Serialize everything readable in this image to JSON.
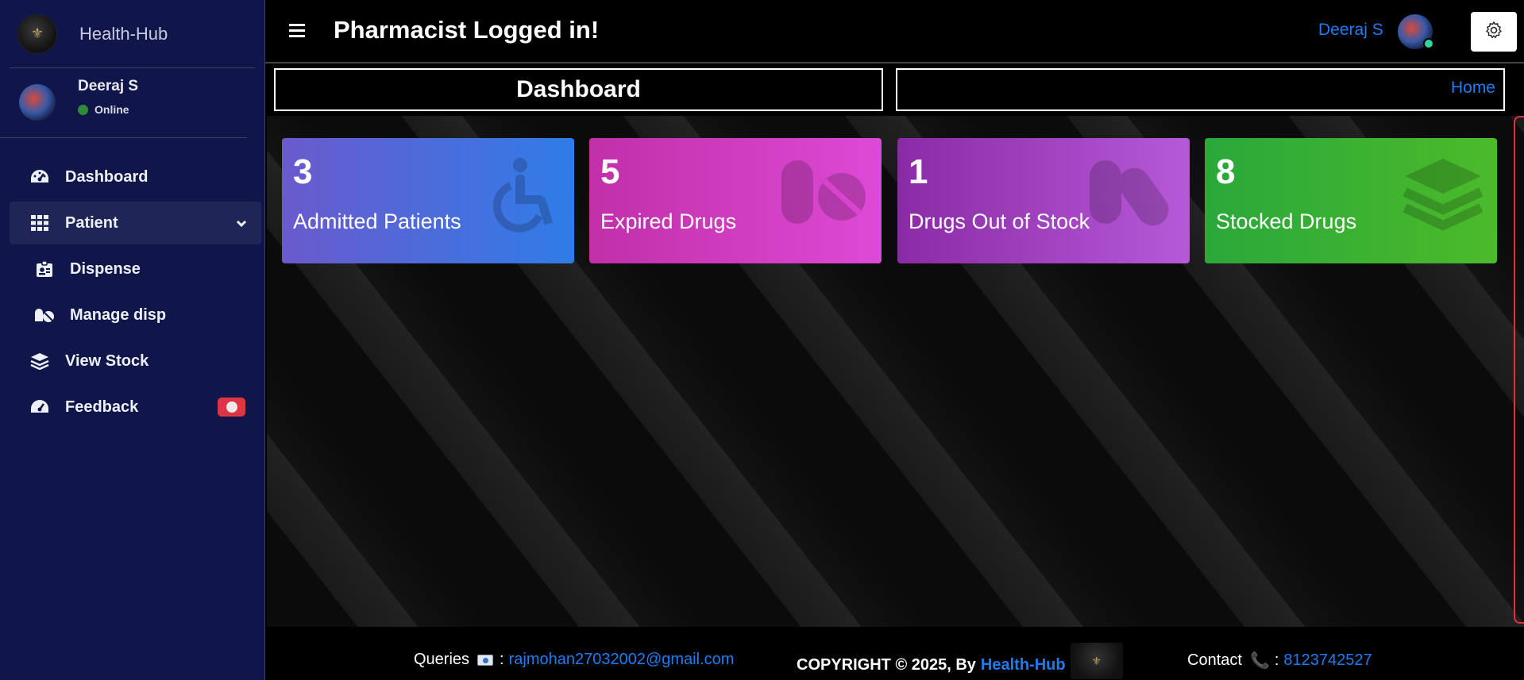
{
  "sidebar": {
    "brand": "Health-Hub",
    "user": {
      "name": "Deeraj S",
      "status": "Online"
    },
    "items": [
      {
        "label": "Dashboard",
        "icon": "tachometer-icon"
      },
      {
        "label": "Patient",
        "icon": "grid-icon"
      },
      {
        "label": "Dispense",
        "icon": "id-badge-icon"
      },
      {
        "label": "Manage disp",
        "icon": "pills-icon"
      },
      {
        "label": "View Stock",
        "icon": "layers-icon"
      },
      {
        "label": "Feedback",
        "icon": "tachometer-icon"
      }
    ]
  },
  "topbar": {
    "title": "Pharmacist Logged in!",
    "username": "Deeraj S"
  },
  "content": {
    "title": "Dashboard",
    "breadcrumb": "Home"
  },
  "cards": [
    {
      "value": "3",
      "label": "Admitted Patients",
      "icon": "wheelchair-icon",
      "color_from": "#6a5acd",
      "color_to": "#2f7de8"
    },
    {
      "value": "5",
      "label": "Expired Drugs",
      "icon": "prescription-bottle-icon",
      "color_from": "#c030a8",
      "color_to": "#dd4ad6"
    },
    {
      "value": "1",
      "label": "Drugs Out of Stock",
      "icon": "capsules-icon",
      "color_from": "#8a2aa6",
      "color_to": "#b75ad8"
    },
    {
      "value": "8",
      "label": "Stocked Drugs",
      "icon": "layers-icon",
      "color_from": "#2aa83a",
      "color_to": "#4cba2a"
    }
  ],
  "footer": {
    "queries_label": "Queries",
    "email": "rajmohan27032002@gmail.com",
    "copyright": "COPYRIGHT © 2025, By",
    "brand": "Health-Hub",
    "contact_label": "Contact",
    "phone": "8123742527"
  },
  "colors": {
    "sidebar_bg": "#11164a",
    "accent_blue": "#1e7bf0",
    "danger": "#dc3545"
  }
}
